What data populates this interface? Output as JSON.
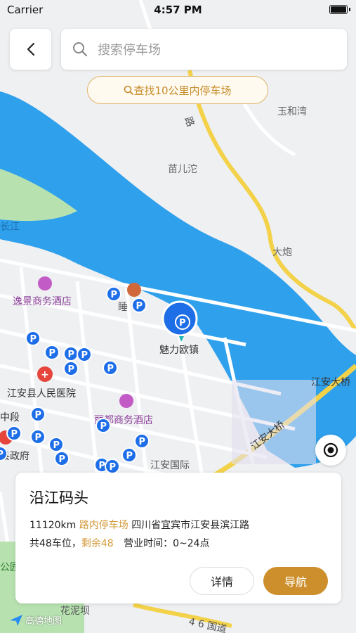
{
  "status_bar": {
    "carrier": "Carrier",
    "time": "4:57 PM"
  },
  "search": {
    "placeholder": "搜索停车场"
  },
  "find_nearby": "查找10公里内停车场",
  "map": {
    "labels": {
      "yuhewan": "玉和湾",
      "miaoertuo": "苗儿沱",
      "dapao": "大炮",
      "changjiang": "长江",
      "yijing_hotel": "逸景商务酒店",
      "shui": "睡",
      "meili_ouzhen": "魅力欧镇",
      "jiangan_bridge_1": "江安大桥",
      "jiangan_bridge_2": "江安大桥",
      "hospital": "江安县人民医院",
      "zhongduan": "中段",
      "lidu_hotel": "丽都商务酒店",
      "gov": "县政府",
      "jiangan_intl": "江安国际",
      "park": "公园",
      "huanieba": "花泥坝",
      "road_46": "4 6 国道",
      "road_lu": "路"
    },
    "parking_marker": "P",
    "highlight_color": "#1e6ee8",
    "river_color": "#2fa0ec",
    "road_color": "#f3d24a"
  },
  "card": {
    "title": "沿江码头",
    "distance": "11120km",
    "type": "路内停车场",
    "address": "四川省宜宾市江安县滨江路",
    "spots": "共48车位，",
    "remaining": "剩余48",
    "hours": "营业时间：0~24点",
    "detail_label": "详情",
    "nav_label": "导航"
  },
  "logo_text": "高德地图"
}
